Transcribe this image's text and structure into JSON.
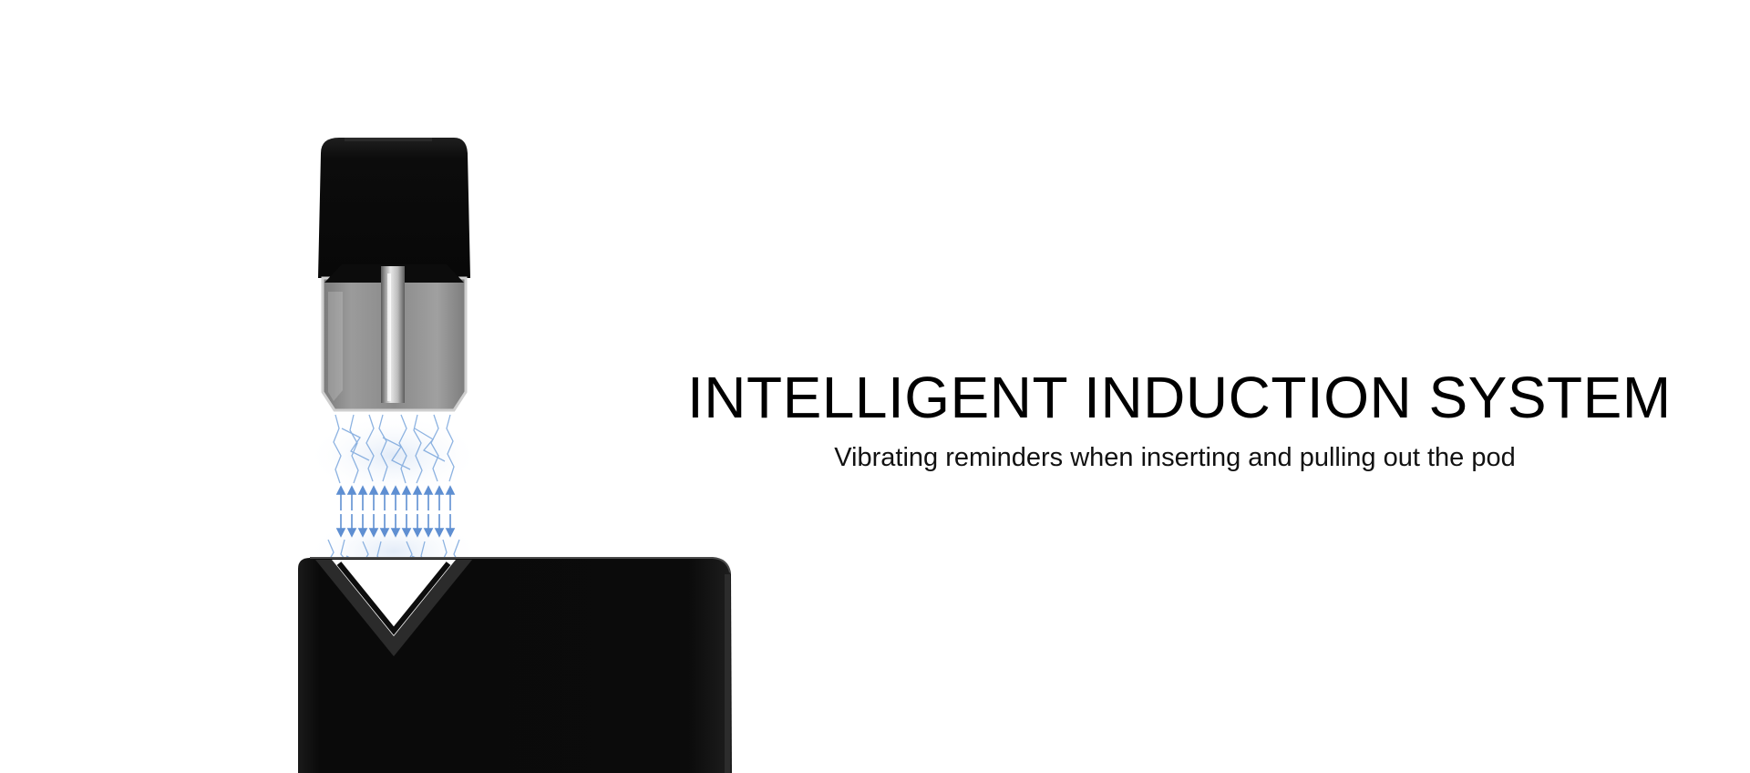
{
  "hero": {
    "headline": "INTELLIGENT INDUCTION SYSTEM",
    "subline": "Vibrating reminders when inserting and pulling out the pod"
  },
  "illustration": {
    "subject": "pod-device-with-induction-field",
    "colors": {
      "device_body": "#0b0b0b",
      "pod_cap": "#0d0d0d",
      "pod_window": "#8f8f8f",
      "field_lines": "#6f9fd8",
      "background": "#ffffff"
    }
  }
}
